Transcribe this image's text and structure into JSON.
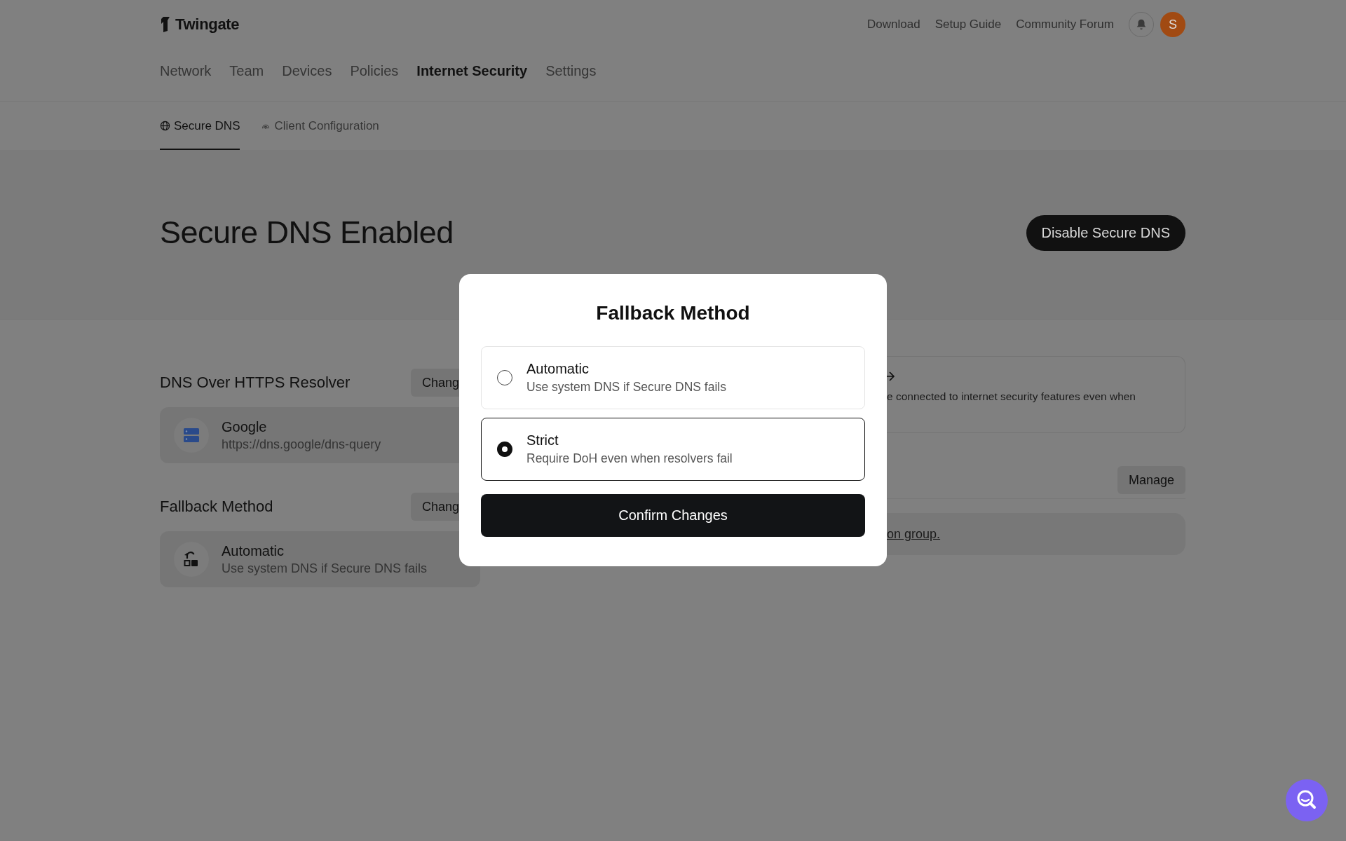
{
  "header": {
    "logo": "Twingate",
    "links": [
      "Download",
      "Setup Guide",
      "Community Forum"
    ],
    "avatar": "S"
  },
  "nav": [
    {
      "label": "Network",
      "selected": false
    },
    {
      "label": "Team",
      "selected": false
    },
    {
      "label": "Devices",
      "selected": false
    },
    {
      "label": "Policies",
      "selected": false
    },
    {
      "label": "Internet Security",
      "selected": true
    },
    {
      "label": "Settings",
      "selected": false
    }
  ],
  "subtabs": [
    {
      "label": "Secure DNS",
      "selected": true
    },
    {
      "label": "Client Configuration",
      "selected": false
    }
  ],
  "hero": {
    "title": "Secure DNS Enabled",
    "button": "Disable Secure DNS"
  },
  "sections": [
    {
      "title": "DNS Over HTTPS Resolver",
      "button": "Chang",
      "name": "Google",
      "detail": "https://dns.google/dns-query"
    },
    {
      "title": "Fallback Method",
      "button": "Chang",
      "name": "Automatic",
      "detail": "Use system DNS if Secure DNS fails"
    }
  ],
  "right": {
    "notice": "e connected to internet security features even when",
    "button": "Manage",
    "link": "on group."
  },
  "modal": {
    "title": "Fallback Method",
    "options": [
      {
        "name": "Automatic",
        "detail": "Use system DNS if Secure DNS fails",
        "selected": false
      },
      {
        "name": "Strict",
        "detail": "Require DoH even when resolvers fail",
        "selected": true
      }
    ],
    "confirm": "Confirm Changes"
  }
}
